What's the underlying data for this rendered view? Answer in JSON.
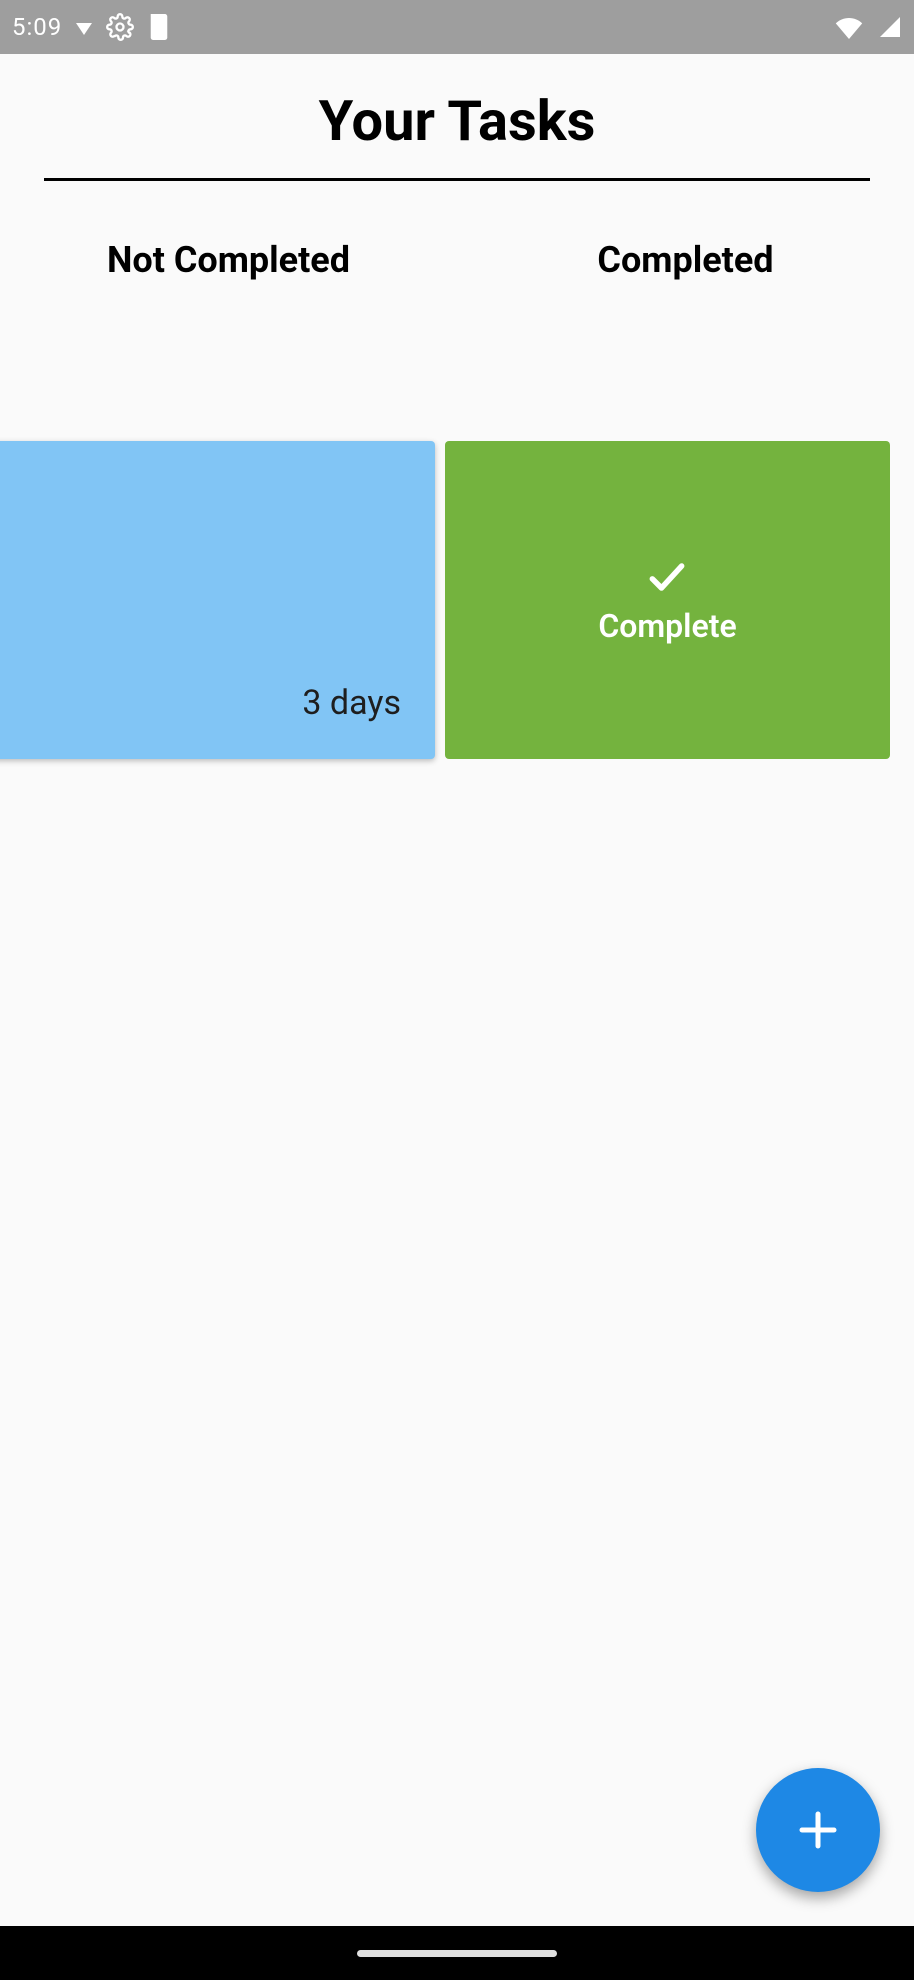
{
  "status_bar": {
    "time": "5:09"
  },
  "header": {
    "title": "Your Tasks"
  },
  "tabs": {
    "not_completed": "Not Completed",
    "completed": "Completed"
  },
  "task_card": {
    "days_text": "3 days",
    "complete_action_label": "Complete"
  },
  "colors": {
    "card_pending_bg": "#81c5f5",
    "card_complete_bg": "#74b33e",
    "fab_bg": "#1e88e5"
  }
}
